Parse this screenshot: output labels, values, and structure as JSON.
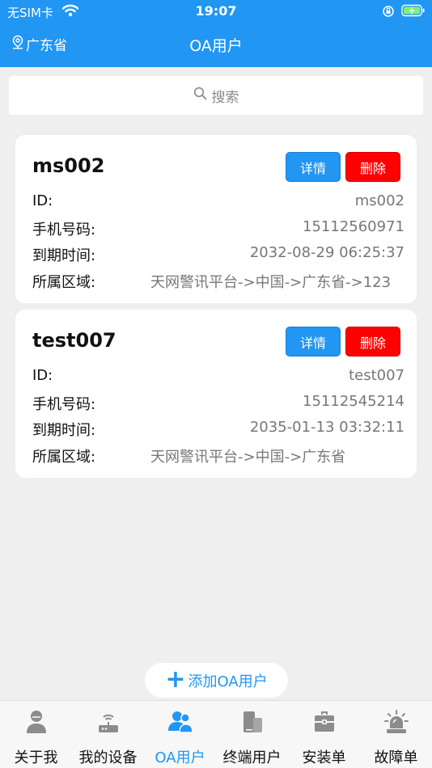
{
  "status_bar": {
    "carrier": "无SIM卡",
    "time": "19:07"
  },
  "header": {
    "location": "广东省",
    "title": "OA用户"
  },
  "search": {
    "placeholder": "搜索"
  },
  "users": [
    {
      "name": "ms002",
      "detail_label": "详情",
      "delete_label": "删除",
      "fields": [
        {
          "label": "ID:",
          "value": "ms002"
        },
        {
          "label": "手机号码:",
          "value": "15112560971"
        },
        {
          "label": "到期时间:",
          "value": "2032-08-29 06:25:37"
        },
        {
          "label": "所属区域:",
          "value": "天网警讯平台->中国->广东省->123"
        }
      ]
    },
    {
      "name": "test007",
      "detail_label": "详情",
      "delete_label": "删除",
      "fields": [
        {
          "label": "ID:",
          "value": "test007"
        },
        {
          "label": "手机号码:",
          "value": "15112545214"
        },
        {
          "label": "到期时间:",
          "value": "2035-01-13 03:32:11"
        },
        {
          "label": "所属区域:",
          "value": "天网警讯平台->中国->广东省"
        }
      ]
    }
  ],
  "add_button": {
    "label": "添加OA用户"
  },
  "tabs": [
    {
      "label": "关于我",
      "icon": "person-icon"
    },
    {
      "label": "我的设备",
      "icon": "router-icon"
    },
    {
      "label": "OA用户",
      "icon": "users-icon"
    },
    {
      "label": "终端用户",
      "icon": "phone-icon"
    },
    {
      "label": "安装单",
      "icon": "toolbox-icon"
    },
    {
      "label": "故障单",
      "icon": "alarm-icon"
    }
  ],
  "colors": {
    "accent": "#2196f3",
    "danger": "#ff0000",
    "background": "#efefef",
    "inactive_icon": "#8c8c8c"
  }
}
